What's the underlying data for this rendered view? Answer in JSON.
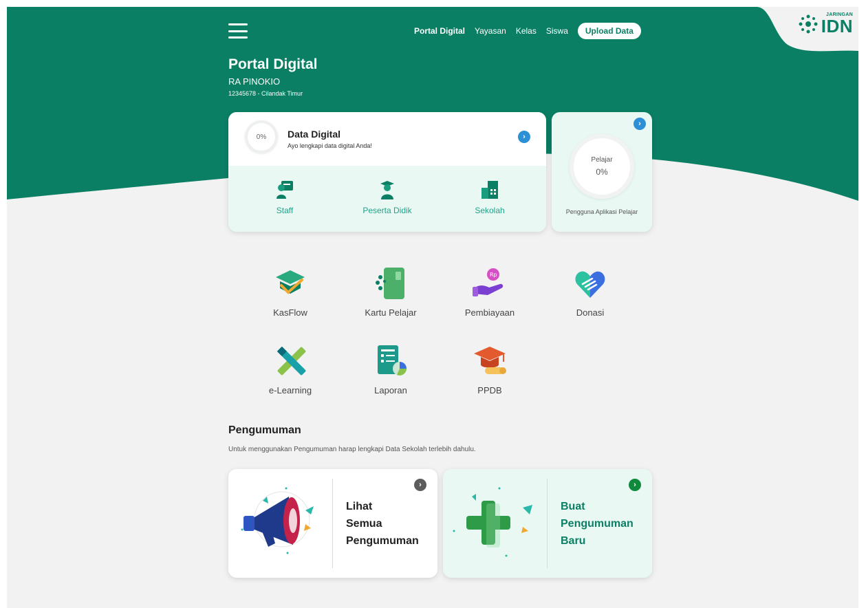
{
  "brand": {
    "tag": "JARINGAN",
    "name": "IDN",
    "color": "#0a7f64"
  },
  "nav": {
    "items": [
      "Portal Digital",
      "Yayasan",
      "Kelas",
      "Siswa"
    ],
    "upload_label": "Upload Data"
  },
  "header": {
    "title": "Portal Digital",
    "school_name": "RA PINOKIO",
    "school_meta": "12345678 - Cilandak Timur"
  },
  "data_digital": {
    "progress": "0%",
    "title": "Data Digital",
    "subtitle": "Ayo lengkapi data digital Anda!",
    "categories": [
      "Staff",
      "Peserta Didik",
      "Sekolah"
    ]
  },
  "pelajar": {
    "label": "Pelajar",
    "value": "0%",
    "caption": "Pengguna Aplikasi Pelajar"
  },
  "apps": [
    "KasFlow",
    "Kartu Pelajar",
    "Pembiayaan",
    "Donasi",
    "e-Learning",
    "Laporan",
    "PPDB"
  ],
  "announcements": {
    "title": "Pengumuman",
    "subtitle": "Untuk menggunakan Pengumuman harap lengkapi Data Sekolah terlebih dahulu.",
    "view_all": [
      "Lihat",
      "Semua",
      "Pengumuman"
    ],
    "create_new": [
      "Buat",
      "Pengumuman",
      "Baru"
    ]
  },
  "icons": {
    "menu": "hamburger-icon",
    "chevron": "chevron-right-icon"
  },
  "colors": {
    "primary": "#0a7f64",
    "accent_blue": "#2d8fd6",
    "card_tint": "#e9f8f2",
    "background": "#f1f2f1"
  }
}
